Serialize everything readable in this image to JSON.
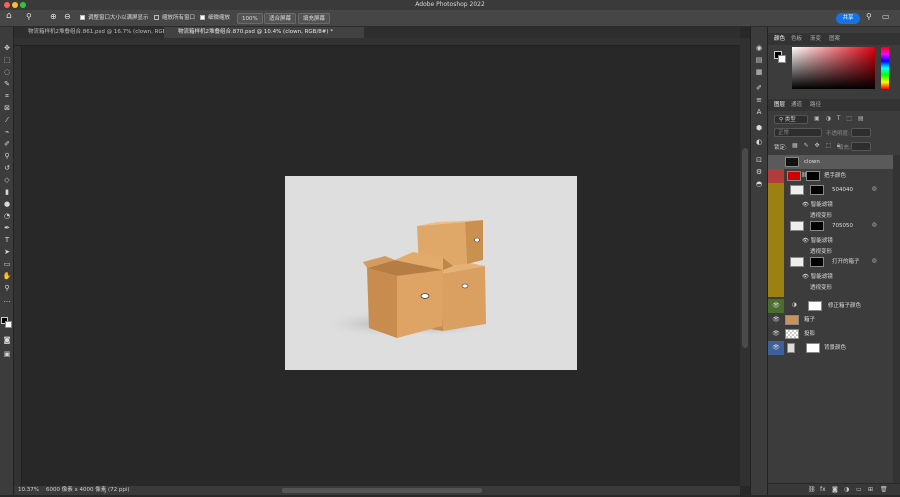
{
  "window": {
    "title": "Adobe Photoshop 2022",
    "share_label": "共享"
  },
  "options": {
    "resize_windows_label": "调整窗口大小以满屏显示",
    "zoom_all_label": "缩放所有窗口",
    "scrubby_zoom_label": "细微缩放",
    "zoom_value": "100%",
    "fit_screen_label": "适合屏幕",
    "fill_screen_label": "填充屏幕"
  },
  "tabs": [
    {
      "label": "物流箱样机2堆叠组合.861.psd @ 16.7% (clown, RGB/8#)"
    },
    {
      "label": "物流箱样机2堆叠组合.870.psd @ 10.4% (clown, RGB/8#) *"
    }
  ],
  "status": {
    "zoom": "10.37%",
    "doc_size": "6000 像素 x 4000 像素 (72 ppi)"
  },
  "color_panel": {
    "tabs": [
      "颜色",
      "色板",
      "渐变",
      "图案"
    ]
  },
  "layers_panel": {
    "tabs": [
      "图层",
      "通道",
      "路径"
    ],
    "filter_kind": "类型",
    "blend_mode": "正常",
    "opacity_label": "不透明度:",
    "lock_label": "锁定:",
    "fill_label": "填充:",
    "layers": [
      {
        "name": "clown"
      },
      {
        "name": "把手颜色"
      },
      {
        "name": "504040"
      },
      {
        "name": "705050"
      },
      {
        "name": "打开的箱子"
      },
      {
        "name": "修正箱子颜色"
      },
      {
        "name": "箱子"
      },
      {
        "name": "投影"
      },
      {
        "name": "背景颜色"
      }
    ],
    "smart_filters_label": "智能滤镜",
    "perspective_label": "透视变形"
  },
  "colors": {
    "orange": "#9c8012",
    "red": "#b23b3b",
    "green": "#4a6e2e",
    "blue": "#3f5f9a"
  }
}
